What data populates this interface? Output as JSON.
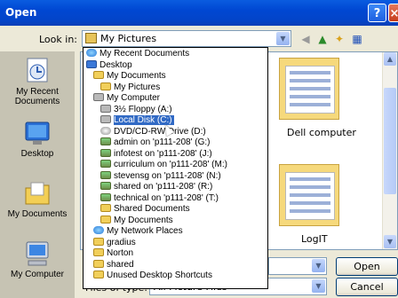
{
  "window": {
    "title": "Open"
  },
  "look_in": {
    "label": "Look in:",
    "value": "My Pictures"
  },
  "places_bar": [
    {
      "label": "My Recent Documents",
      "icon": "recent-documents-icon"
    },
    {
      "label": "Desktop",
      "icon": "desktop-icon"
    },
    {
      "label": "My Documents",
      "icon": "my-documents-icon"
    },
    {
      "label": "My Computer",
      "icon": "my-computer-icon"
    }
  ],
  "look_in_dropdown": [
    {
      "label": "My Recent Documents",
      "icon": "recent-icon",
      "level": 0
    },
    {
      "label": "Desktop",
      "icon": "desktop-icon",
      "level": 0
    },
    {
      "label": "My Documents",
      "icon": "folder-icon",
      "level": 1
    },
    {
      "label": "My Pictures",
      "icon": "folder-icon",
      "level": 2
    },
    {
      "label": "My Computer",
      "icon": "computer-icon",
      "level": 1
    },
    {
      "label": "3½ Floppy (A:)",
      "icon": "floppy-icon",
      "level": 2
    },
    {
      "label": "Local Disk (C:)",
      "icon": "drive-icon",
      "level": 2,
      "selected": true
    },
    {
      "label": "DVD/CD-RW Drive (D:)",
      "icon": "cd-icon",
      "level": 2
    },
    {
      "label": "admin on 'p111-208' (G:)",
      "icon": "network-drive-icon",
      "level": 2
    },
    {
      "label": "infotest on 'p111-208' (J:)",
      "icon": "network-drive-icon",
      "level": 2
    },
    {
      "label": "curriculum on 'p111-208' (M:)",
      "icon": "network-drive-icon",
      "level": 2
    },
    {
      "label": "stevensg on 'p111-208' (N:)",
      "icon": "network-drive-icon",
      "level": 2
    },
    {
      "label": "shared on 'p111-208' (R:)",
      "icon": "network-drive-icon",
      "level": 2
    },
    {
      "label": "technical on 'p111-208' (T:)",
      "icon": "network-drive-icon",
      "level": 2
    },
    {
      "label": "Shared Documents",
      "icon": "folder-icon",
      "level": 2
    },
    {
      "label": "My Documents",
      "icon": "folder-icon",
      "level": 2
    },
    {
      "label": "My Network Places",
      "icon": "network-places-icon",
      "level": 1
    },
    {
      "label": "gradius",
      "icon": "folder-icon",
      "level": 1
    },
    {
      "label": "Norton",
      "icon": "folder-icon",
      "level": 1
    },
    {
      "label": "shared",
      "icon": "folder-icon",
      "level": 1
    },
    {
      "label": "Unused Desktop Shortcuts",
      "icon": "folder-icon",
      "level": 1
    }
  ],
  "files": [
    {
      "label": "Dell computer"
    },
    {
      "label": "LogIT"
    }
  ],
  "bottom": {
    "files_of_type_label": "Files of type:",
    "files_of_type_value": "All Picture Files",
    "open_label": "Open",
    "cancel_label": "Cancel"
  }
}
